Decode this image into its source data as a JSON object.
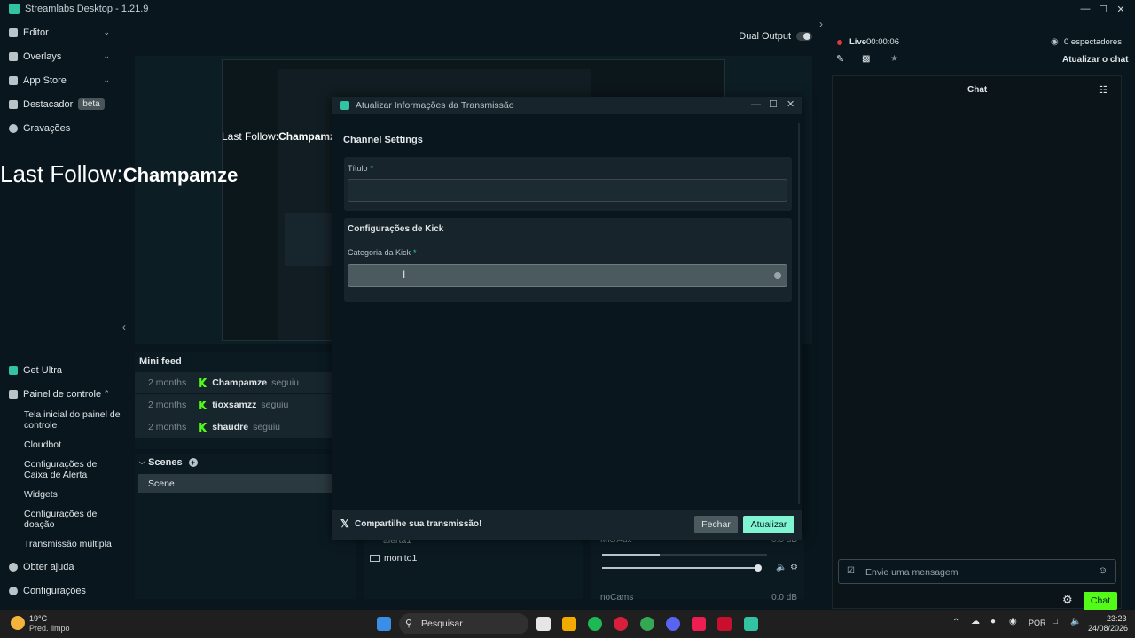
{
  "window": {
    "title": "Streamlabs Desktop - 1.21.9"
  },
  "sidebar": {
    "items": [
      {
        "label": "Editor",
        "icon": "editor-icon"
      },
      {
        "label": "Overlays",
        "icon": "overlays-icon"
      },
      {
        "label": "App Store",
        "icon": "app-store-icon"
      },
      {
        "label": "Destacador",
        "icon": "highlighter-icon",
        "badge": "beta"
      },
      {
        "label": "Gravações",
        "icon": "recordings-icon"
      }
    ],
    "bottom": {
      "get_ultra": "Get Ultra",
      "dashboard": "Painel de controle",
      "sub": [
        "Tela inicial do painel de controle",
        "Cloudbot",
        "Configurações de Caixa de Alerta",
        "Widgets",
        "Configurações de doação",
        "Transmissão múltipla"
      ],
      "help": "Obter ajuda",
      "settings": "Configurações"
    }
  },
  "toolbar": {
    "dual_output": "Dual Output"
  },
  "preview": {
    "last_follow_label": "Last Follow:",
    "last_follow_name": "Champamze"
  },
  "mini_feed": {
    "title": "Mini feed",
    "rows": [
      {
        "time": "2 months",
        "name": "Champamze",
        "action": "seguiu"
      },
      {
        "time": "2 months",
        "name": "tioxsamzz",
        "action": "seguiu"
      },
      {
        "time": "2 months",
        "name": "shaudre",
        "action": "seguiu"
      }
    ]
  },
  "scenes": {
    "title": "Scenes",
    "items": [
      "Scene"
    ]
  },
  "sources": {
    "items": [
      "alerta1",
      "monito1"
    ]
  },
  "mixer": {
    "items": [
      {
        "name": "Mic/Aux",
        "level": "0.0 dB",
        "fill": 0.35
      },
      {
        "name": "noCams",
        "level": "0.0 dB"
      }
    ]
  },
  "modal": {
    "title": "Atualizar Informações da Transmissão",
    "section": "Channel Settings",
    "title_label": "Título",
    "title_value": "",
    "kick_section": "Configurações de Kick",
    "category_label": "Categoria da Kick",
    "category_value": "",
    "required_mark": "*",
    "share": "Compartilhe sua transmissão!",
    "close_btn": "Fechar",
    "update_btn": "Atualizar"
  },
  "right": {
    "live": "Live",
    "timer": "00:00:06",
    "viewers": "0 espectadores",
    "refresh_chat": "Atualizar o chat",
    "chat_title": "Chat",
    "message_placeholder": "Envie uma mensagem",
    "chat_btn": "Chat"
  },
  "taskbar": {
    "weather_temp": "19°C",
    "weather_desc": "Pred. limpo",
    "search": "Pesquisar",
    "lang": "POR",
    "time": "23:23",
    "date": "24/08/2026"
  },
  "colors": {
    "accent": "#31c3a2",
    "kick": "#53fc18",
    "live": "#e0383e",
    "chat_btn": "#53fc18"
  }
}
